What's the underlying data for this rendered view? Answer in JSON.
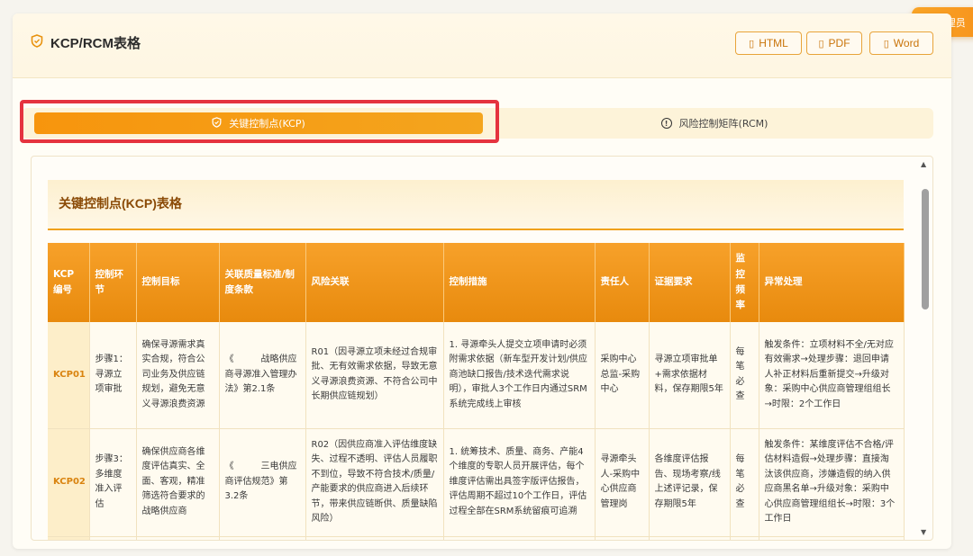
{
  "user": {
    "label": "管理员"
  },
  "header": {
    "title": "KCP/RCM表格",
    "export": {
      "html": "HTML",
      "pdf": "PDF",
      "word": "Word"
    }
  },
  "tabs": [
    {
      "label": "关键控制点(KCP)",
      "active": true
    },
    {
      "label": "风险控制矩阵(RCM)",
      "active": false
    }
  ],
  "section": {
    "title": "关键控制点(KCP)表格"
  },
  "table": {
    "headers": [
      "KCP编号",
      "控制环节",
      "控制目标",
      "关联质量标准/制度条款",
      "风险关联",
      "控制措施",
      "责任人",
      "证据要求",
      "监控频率",
      "异常处理"
    ],
    "rows": [
      {
        "id": "KCP01",
        "step": "步骤1：寻源立项审批",
        "goal": "确保寻源需求真实合规，符合公司业务及供应链规划，避免无意义寻源浪费资源",
        "standard": "《　　　战略供应商寻源准入管理办法》第2.1条",
        "risk": "R01（因寻源立项未经过合规审批、无有效需求依据，导致无意义寻源浪费资源、不符合公司中长期供应链规划）",
        "measure": "1. 寻源牵头人提交立项申请时必须附需求依据（新车型开发计划/供应商池缺口报告/技术迭代需求说明），审批人3个工作日内通过SRM系统完成线上审核",
        "owner": "采购中心总监-采购中心",
        "evidence": "寻源立项审批单+需求依据材料，保存期限5年",
        "freq": "每笔必查",
        "exception": "触发条件：立项材料不全/无对应有效需求→处理步骤：退回申请人补正材料后重新提交→升级对象：采购中心供应商管理组组长→时限：2个工作日"
      },
      {
        "id": "KCP02",
        "step": "步骤3：多维度准入评估",
        "goal": "确保供应商各维度评估真实、全面、客观，精准筛选符合要求的战略供应商",
        "standard": "《　　　三电供应商评估规范》第3.2条",
        "risk": "R02（因供应商准入评估维度缺失、过程不透明、评估人员履职不到位，导致不符合技术/质量/产能要求的供应商进入后续环节，带来供应链断供、质量缺陷风险）",
        "measure": "1. 统筹技术、质量、商务、产能4个维度的专职人员开展评估，每个维度评估需出具签字版评估报告，评估周期不超过10个工作日，评估过程全部在SRM系统留痕可追溯",
        "owner": "寻源牵头人-采购中心供应商管理岗",
        "evidence": "各维度评估报告、现场考察/线上述评记录，保存期限5年",
        "freq": "每笔必查",
        "exception": "触发条件：某维度评估不合格/评估材料造假→处理步骤：直接淘汰该供应商，涉嫌造假的纳入供应商黑名单→升级对象：采购中心供应商管理组组长→时限：3个工作日"
      }
    ]
  }
}
